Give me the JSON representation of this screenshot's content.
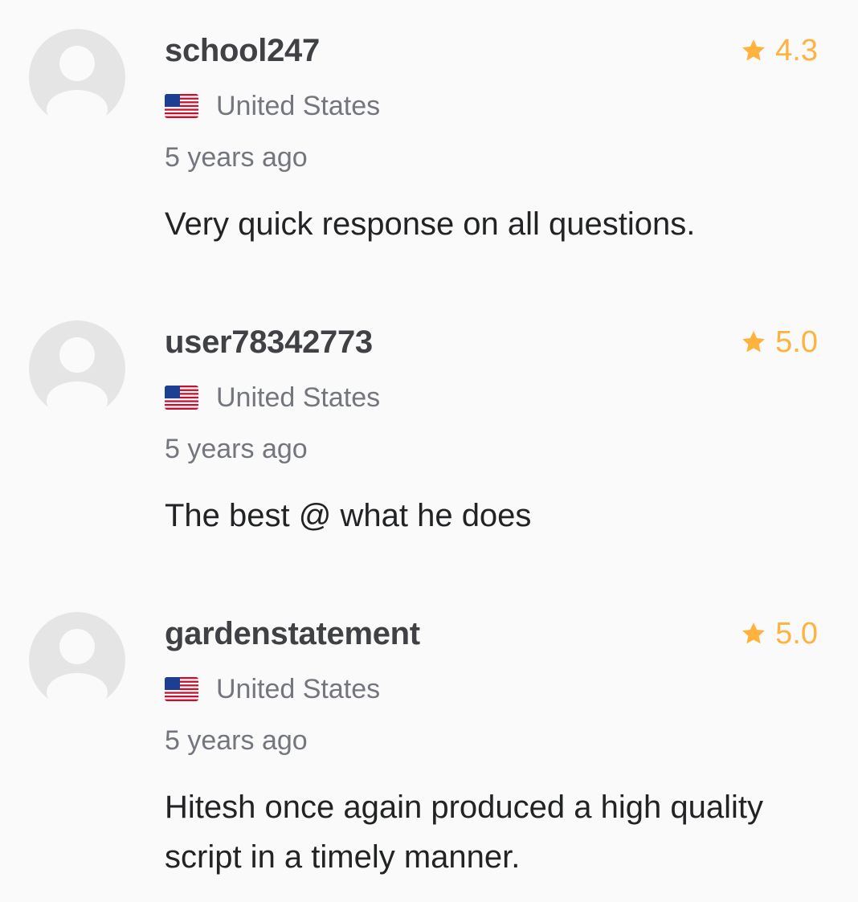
{
  "reviews": [
    {
      "username": "school247",
      "rating": "4.3",
      "country": "United States",
      "flag": "us-flag-icon",
      "time": "5 years ago",
      "comment": "Very quick response on all questions."
    },
    {
      "username": "user78342773",
      "rating": "5.0",
      "country": "United States",
      "flag": "us-flag-icon",
      "time": "5 years ago",
      "comment": "The best @ what he does"
    },
    {
      "username": "gardenstatement",
      "rating": "5.0",
      "country": "United States",
      "flag": "us-flag-icon",
      "time": "5 years ago",
      "comment": "Hitesh once again produced a high quality script in a timely manner."
    }
  ],
  "colors": {
    "background": "#fafafa",
    "username": "#404145",
    "muted": "#74767e",
    "comment": "#222325",
    "star": "#ffb33e",
    "avatar": "#e5e5e6"
  }
}
